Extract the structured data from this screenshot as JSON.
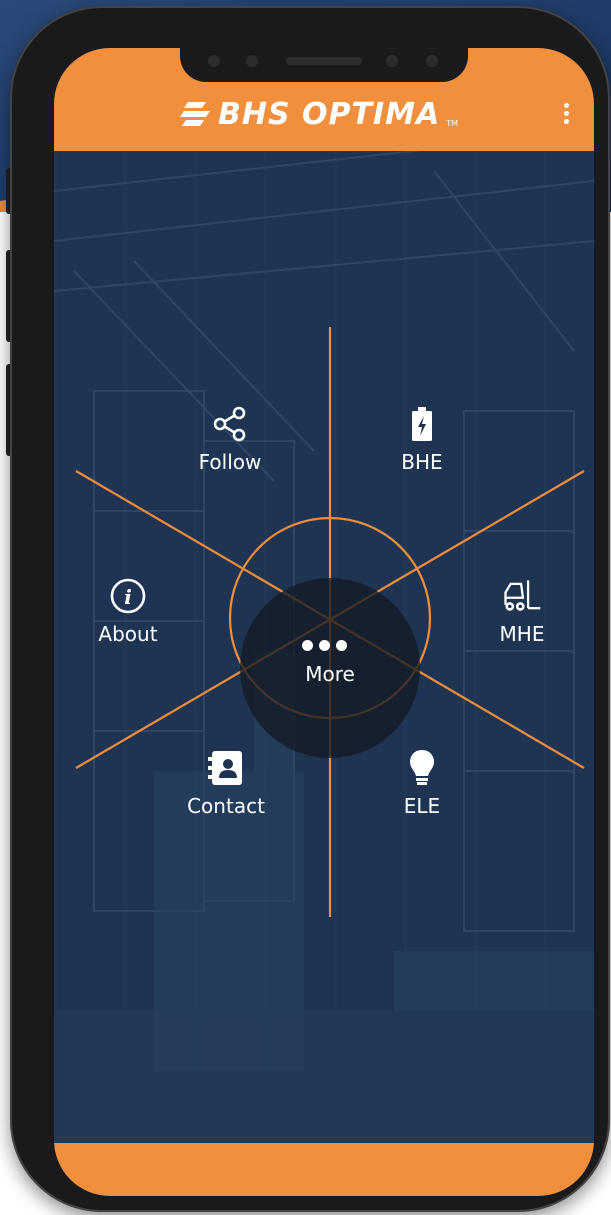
{
  "app": {
    "brand": "BHS OPTIMA",
    "trademark": "TM"
  },
  "menu": {
    "center": {
      "label": "More",
      "icon": "more-dots-icon"
    },
    "items": [
      {
        "key": "follow",
        "label": "Follow",
        "icon": "share-icon"
      },
      {
        "key": "bhe",
        "label": "BHE",
        "icon": "battery-charging-icon"
      },
      {
        "key": "about",
        "label": "About",
        "icon": "info-icon"
      },
      {
        "key": "mhe",
        "label": "MHE",
        "icon": "forklift-icon"
      },
      {
        "key": "contact",
        "label": "Contact",
        "icon": "contact-book-icon"
      },
      {
        "key": "ele",
        "label": "ELE",
        "icon": "lightbulb-icon"
      }
    ]
  },
  "colors": {
    "accent": "#f28f3c",
    "screen_bg": "#1d3350",
    "text": "#ffffff"
  }
}
